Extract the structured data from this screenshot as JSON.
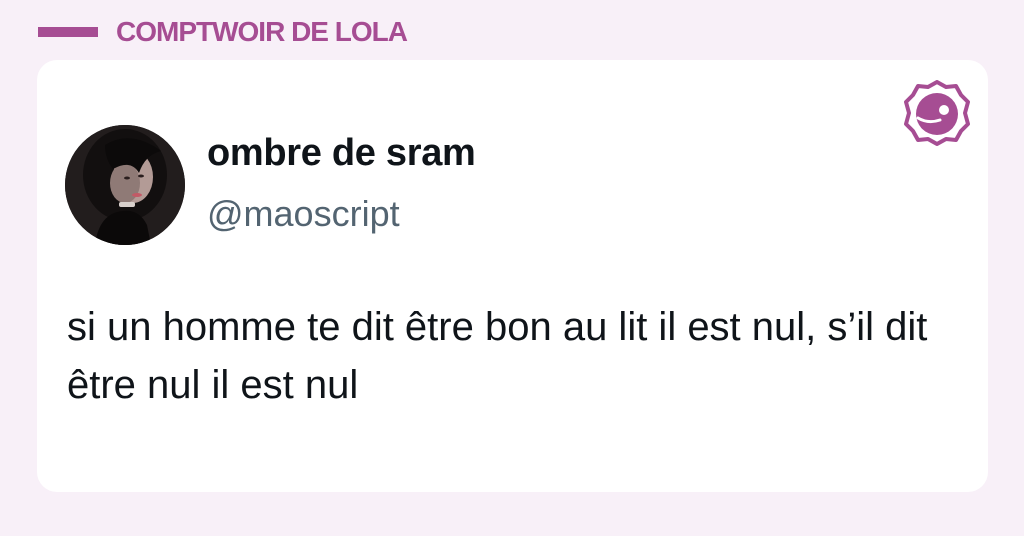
{
  "header": {
    "title": "COMPTWOIR DE LOLA",
    "accent_color": "#a64d93"
  },
  "tweet": {
    "display_name": "ombre de sram",
    "handle": "@maoscript",
    "text": "si un homme te dit être bon au lit il est nul, s’il dit être nul il est nul",
    "avatar_icon": "user-avatar-photo"
  },
  "brand": {
    "icon": "comptwoir-logo-icon"
  }
}
